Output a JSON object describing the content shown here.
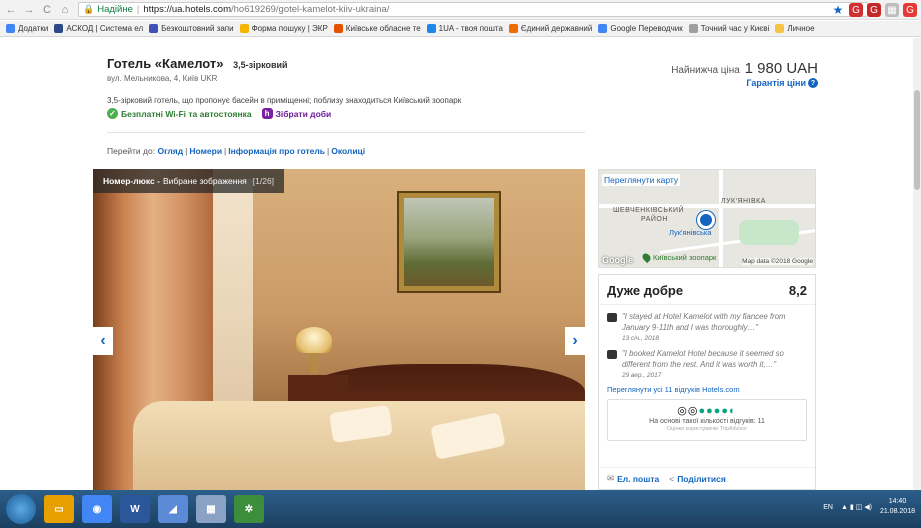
{
  "browser": {
    "secure_label": "Надійне",
    "url_host": "https://ua.hotels.com",
    "url_path": "/ho619269/gotel-kamelot-kiiv-ukraina/"
  },
  "bookmarks": [
    {
      "label": "Додатки",
      "color": "#4285f4"
    },
    {
      "label": "АСКОД | Система ел",
      "color": "#2d4a86"
    },
    {
      "label": "Безкоштовний запи",
      "color": "#3f51b5"
    },
    {
      "label": "Форма пошуку | ЭКР",
      "color": "#f4b400"
    },
    {
      "label": "Київське обласне те",
      "color": "#e65100"
    },
    {
      "label": "1UA - твоя пошта",
      "color": "#1e88e5"
    },
    {
      "label": "Єдиний державний",
      "color": "#ef6c00"
    },
    {
      "label": "Google Переводчик",
      "color": "#4285f4"
    },
    {
      "label": "Точний час у Києві",
      "color": "#9e9e9e"
    },
    {
      "label": "Личное",
      "color": "#f6c344"
    }
  ],
  "hotel": {
    "name": "Готель «Камелот»",
    "stars": "3,5-зірковий",
    "address": "вул. Мельникова, 4, Київ UKR",
    "description": "3,5-зірковий готель, що пропонує басейн в приміщенні; поблизу знаходиться Київський зоопарк",
    "amenity_wifi": "Безплатні Wi-Fi та автостоянка",
    "amenity_points": "Зібрати доби"
  },
  "price": {
    "label": "Найнижча ціна",
    "value": "1 980 UAH",
    "guarantee": "Гарантія ціни"
  },
  "jump": {
    "label": "Перейти до:",
    "links": [
      "Огляд",
      "Номери",
      "Інформація про готель",
      "Околиці"
    ]
  },
  "gallery": {
    "room": "Номер-люкс -",
    "caption": "Вибране зображення",
    "counter": "[1/26]"
  },
  "map": {
    "link": "Переглянути карту",
    "label_district1": "ЛУК'ЯНІВКА",
    "label_district2": "ШЕВЧЕНКІВСЬКИЙ",
    "label_district3": "РАЙОН",
    "metro": "Лук'янівська",
    "zoo": "Київський зоопарк",
    "google": "Google",
    "credit": "Map data ©2018 Google"
  },
  "reviews": {
    "title": "Дуже добре",
    "score": "8,2",
    "items": [
      {
        "text": "\"I stayed at Hotel Kamelot with my fiancee from January 9-11th and I was thoroughly…\"",
        "date": "13 січ., 2018"
      },
      {
        "text": "\"I booked Kamelot Hotel because it seemed so different from the rest. And it was worth it,…\"",
        "date": "29 вер., 2017"
      }
    ],
    "all_link": "Переглянути усі 11 відгуків Hotels.com",
    "ta_based": "На основі такої кількості відгуків: 11",
    "ta_caption": "Оцінки користувачів TripAdvisor",
    "email": "Ел. пошта",
    "share": "Поділитися"
  },
  "taskbar": {
    "lang": "EN",
    "time": "14:40",
    "date": "21.08.2018"
  }
}
